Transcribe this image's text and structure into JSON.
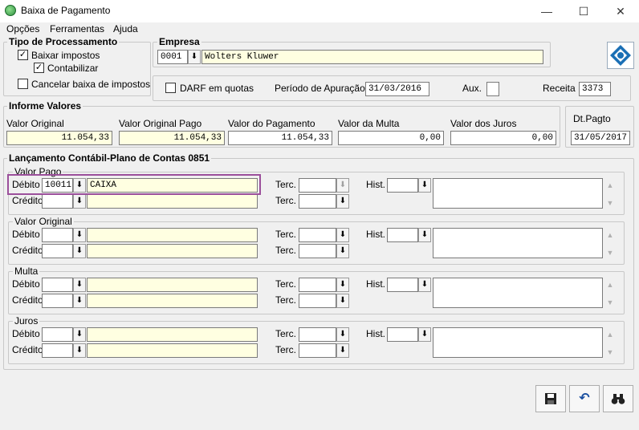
{
  "window": {
    "title": "Baixa de Pagamento",
    "minimize": "—",
    "maximize": "☐",
    "close": "✕"
  },
  "menu": [
    "Opções",
    "Ferramentas",
    "Ajuda"
  ],
  "tipo_processamento": {
    "title": "Tipo de Processamento",
    "baixar_impostos": {
      "label": "Baixar impostos",
      "checked": "✓"
    },
    "contabilizar": {
      "label": "Contabilizar",
      "checked": "✓"
    },
    "cancelar_baixa": {
      "label": "Cancelar baixa de impostos",
      "checked": ""
    }
  },
  "empresa": {
    "title": "Empresa",
    "code": "0001",
    "name": "Wolters Kluwer",
    "darf_label": "DARF em quotas",
    "periodo_label": "Período de Apuração",
    "periodo_value": "31/03/2016",
    "aux_label": "Aux.",
    "aux_value": "",
    "receita_label": "Receita",
    "receita_value": "3373"
  },
  "informe": {
    "title": "Informe Valores",
    "valor_original_label": "Valor Original",
    "valor_original": "11.054,33",
    "valor_original_pago_label": "Valor Original Pago",
    "valor_original_pago": "11.054,33",
    "valor_pagamento_label": "Valor do Pagamento",
    "valor_pagamento": "11.054,33",
    "valor_multa_label": "Valor da Multa",
    "valor_multa": "0,00",
    "valor_juros_label": "Valor dos Juros",
    "valor_juros": "0,00"
  },
  "dt_pagto": {
    "label": "Dt.Pagto",
    "value": "31/05/2017"
  },
  "lancamento": {
    "title": "Lançamento Contábil-Plano de Contas 0851",
    "debito_label": "Débito",
    "credito_label": "Crédito",
    "terc_label": "Terc.",
    "hist_label": "Hist.",
    "sections": [
      {
        "title": "Valor Pago",
        "debito_code": "10011",
        "debito_name": "CAIXA",
        "credito_code": "",
        "credito_name": ""
      },
      {
        "title": "Valor Original",
        "debito_code": "",
        "debito_name": "",
        "credito_code": "",
        "credito_name": ""
      },
      {
        "title": "Multa",
        "debito_code": "",
        "debito_name": "",
        "credito_code": "",
        "credito_name": ""
      },
      {
        "title": "Juros",
        "debito_code": "",
        "debito_name": "",
        "credito_code": "",
        "credito_name": ""
      }
    ]
  },
  "icons": {
    "lookup": "⬇",
    "save": "💾",
    "undo": "↶",
    "search": "🔭",
    "scroll_up": "▲",
    "scroll_down": "▼"
  },
  "colors": {
    "highlight": "#9b4f9b",
    "field_yellow": "#ffffe1"
  }
}
